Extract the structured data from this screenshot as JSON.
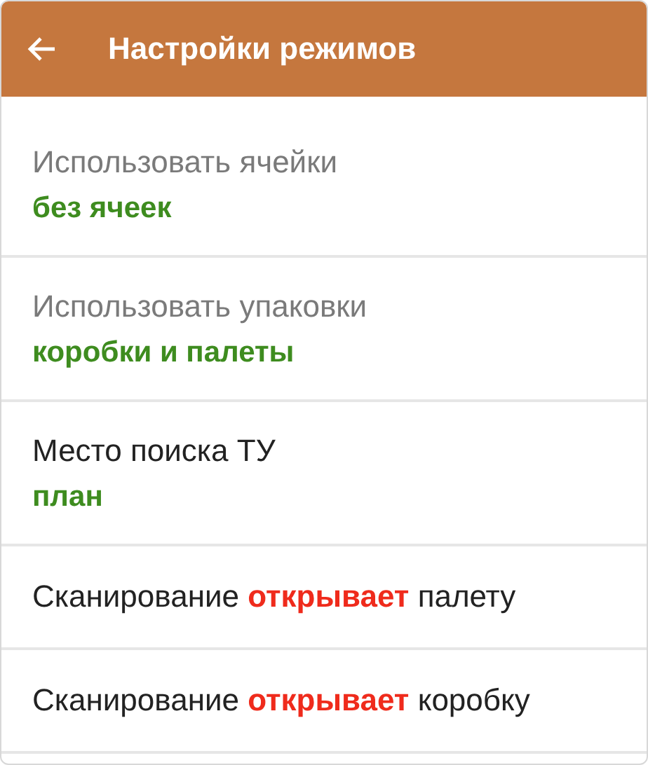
{
  "header": {
    "title": "Настройки режимов"
  },
  "settings": [
    {
      "kind": "choice",
      "label": "Использовать ячейки",
      "value": "без ячеек",
      "disabled": true
    },
    {
      "kind": "choice",
      "label": "Использовать упаковки",
      "value": "коробки и палеты",
      "disabled": true
    },
    {
      "kind": "choice",
      "label": "Место поиска ТУ",
      "value": "план",
      "disabled": false
    },
    {
      "kind": "sentence",
      "text": "Сканирование **открывает** палету"
    },
    {
      "kind": "sentence",
      "text": "Сканирование **открывает** коробку"
    }
  ]
}
